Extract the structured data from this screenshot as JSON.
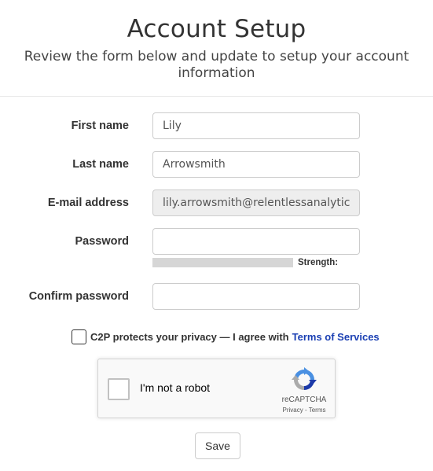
{
  "header": {
    "title": "Account Setup",
    "subtitle": "Review the form below and update to setup your account information"
  },
  "form": {
    "first_name": {
      "label": "First name",
      "value": "Lily"
    },
    "last_name": {
      "label": "Last name",
      "value": "Arrowsmith"
    },
    "email": {
      "label": "E-mail address",
      "value": "lily.arrowsmith@relentlessanalytic"
    },
    "password": {
      "label": "Password",
      "value": ""
    },
    "strength_label": "Strength:",
    "confirm_password": {
      "label": "Confirm password",
      "value": ""
    },
    "agree_text": "C2P protects your privacy — I agree with",
    "terms_link": "Terms of Services"
  },
  "recaptcha": {
    "label": "I'm not a robot",
    "brand": "reCAPTCHA",
    "links": "Privacy - Terms",
    "icon": "recaptcha-logo-icon"
  },
  "actions": {
    "save_label": "Save"
  },
  "colors": {
    "link": "#1a3fb3",
    "disabled_bg": "#eeeeee",
    "strength_bar": "#d6d6d6"
  }
}
